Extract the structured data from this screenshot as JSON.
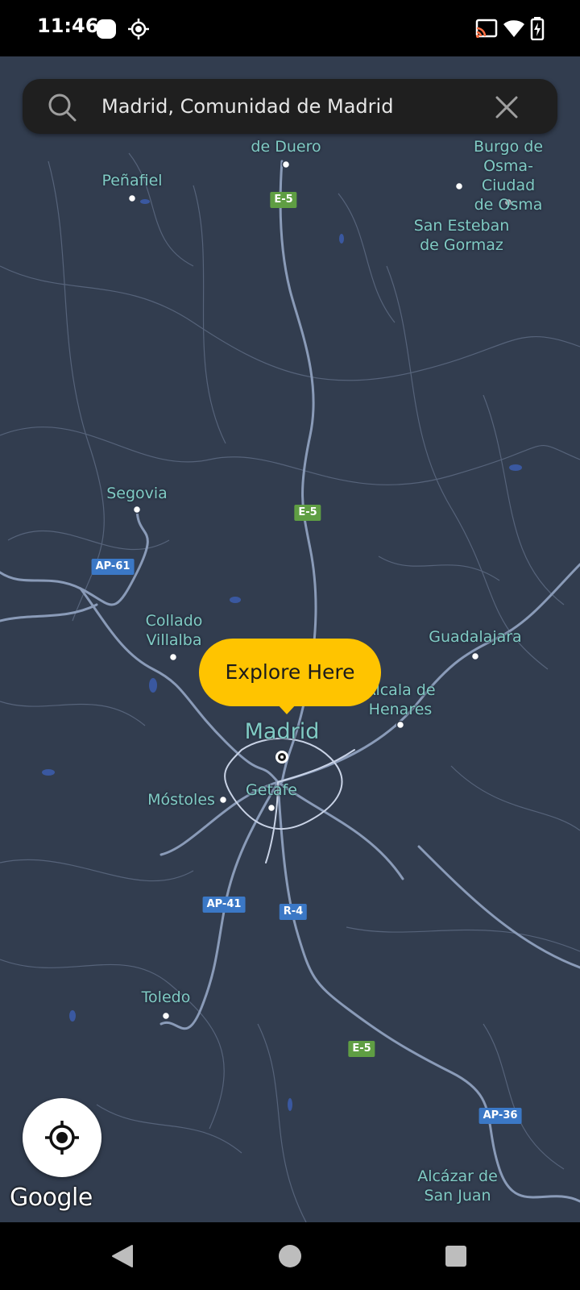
{
  "status_bar": {
    "time": "11:46",
    "icons": [
      "app-notification-icon",
      "location-icon",
      "cast-icon",
      "wifi-icon",
      "battery-charging-icon"
    ]
  },
  "search": {
    "icon": "search-icon",
    "value": "Madrid, Comunidad de Madrid",
    "clear_icon": "close-icon"
  },
  "map": {
    "places": {
      "aranda": "de Duero",
      "penafiel": "Peñafiel",
      "burgo": "Burgo de\nOsma-Ciudad\nde Osma",
      "san_esteban": "San Esteban\nde Gormaz",
      "segovia": "Segovia",
      "collado": "Collado\nVillalba",
      "guadalajara": "Guadalajara",
      "alcala": "Alcala de\nHenares",
      "madrid": "Madrid",
      "mostoles": "Móstoles",
      "getafe": "Getafe",
      "toledo": "Toledo",
      "alcazar": "Alcázar de\nSan Juan"
    },
    "road_shields": {
      "e5_top": "E-5",
      "e5_mid": "E-5",
      "e5_bottom": "E-5",
      "ap61": "AP-61",
      "ap41": "AP-41",
      "r4": "R-4",
      "ap36": "AP-36"
    },
    "colors": {
      "background": "#323d4f",
      "road": "#8a9bb8",
      "label": "#80cbc4",
      "shield_green": "#5f9e43",
      "shield_blue": "#3b78c6"
    }
  },
  "explore_button": {
    "label": "Explore Here",
    "color": "#ffc400"
  },
  "locate_button": {
    "icon": "my-location-icon"
  },
  "attribution": "Google",
  "nav_bar": {
    "icons": [
      "back-icon",
      "home-icon",
      "recents-icon"
    ]
  }
}
